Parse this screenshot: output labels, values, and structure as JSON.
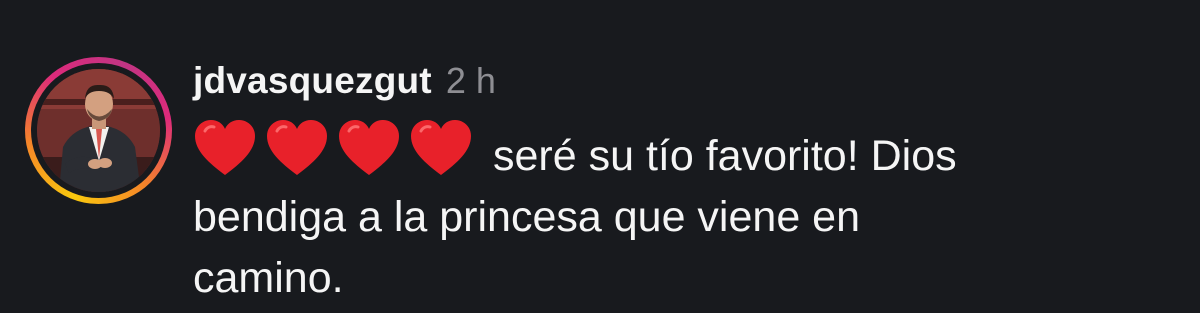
{
  "comment": {
    "username": "jdvasquezgut",
    "timestamp": "2 h",
    "emoji": [
      "red-heart-icon",
      "red-heart-icon",
      "red-heart-icon",
      "red-heart-icon"
    ],
    "text_line_1": "seré su tío favorito! Dios",
    "text_line_2": "bendiga a la princesa que viene en",
    "text_line_3": "camino."
  },
  "colors": {
    "background": "#181a1e",
    "text": "#f5f5f5",
    "timestamp": "#8e8e93",
    "heart": "#e8212a",
    "story_ring": [
      "#f9c80e",
      "#f58529",
      "#dd2a7b",
      "#c13584"
    ]
  }
}
